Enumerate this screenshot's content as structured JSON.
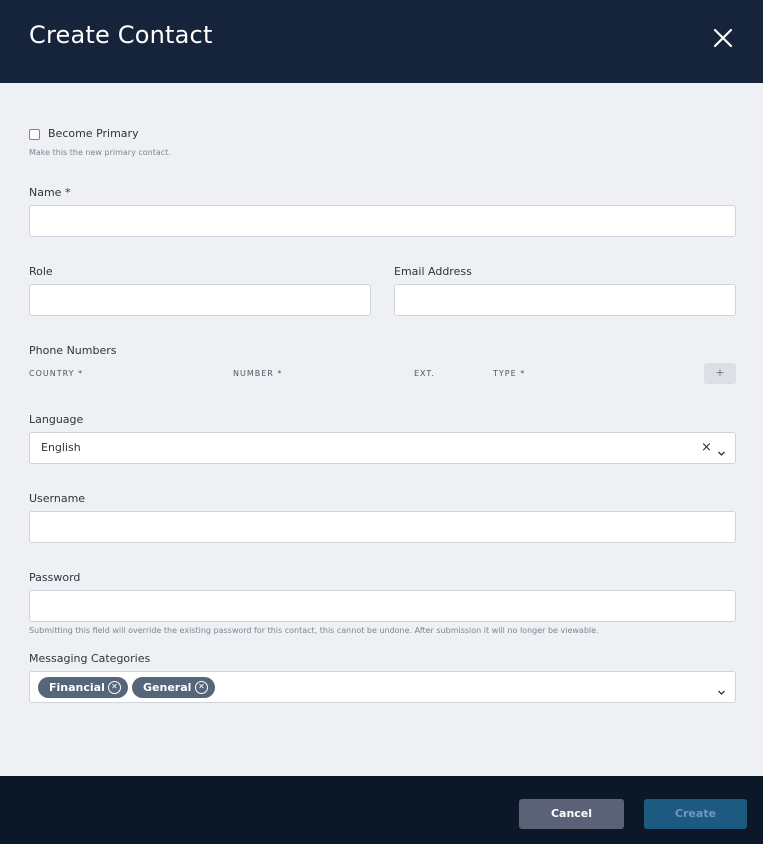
{
  "header": {
    "title": "Create Contact",
    "close_icon": "close-icon"
  },
  "primary": {
    "label": "Become Primary",
    "hint": "Make this the new primary contact."
  },
  "name": {
    "label": "Name *",
    "value": ""
  },
  "role": {
    "label": "Role",
    "value": ""
  },
  "email": {
    "label": "Email Address",
    "value": ""
  },
  "phones": {
    "label": "Phone Numbers",
    "columns": [
      "COUNTRY *",
      "NUMBER *",
      "EXT.",
      "TYPE *"
    ],
    "add_label": "+"
  },
  "language": {
    "label": "Language",
    "value": "English",
    "clear": "×"
  },
  "username": {
    "label": "Username",
    "value": ""
  },
  "password": {
    "label": "Password",
    "value": "",
    "hint": "Submitting this field will override the existing password for this contact, this cannot be undone. After submission it will no longer be viewable."
  },
  "messaging": {
    "label": "Messaging Categories",
    "chips": [
      "Financial",
      "General"
    ]
  },
  "footer": {
    "cancel_label": "Cancel",
    "create_label": "Create"
  },
  "colors": {
    "header_bg": "#15243a",
    "footer_bg": "#0c1728",
    "chip_bg": "#55657a",
    "create_bg": "#1c5a82",
    "cancel_bg": "#5b6277"
  }
}
